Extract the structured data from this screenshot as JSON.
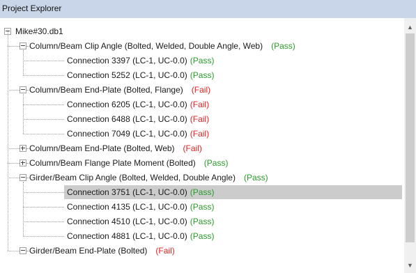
{
  "panel": {
    "title": "Project Explorer"
  },
  "tree": {
    "root": {
      "label": "Mike#30.db1"
    },
    "groups": [
      {
        "label": "Column/Beam Clip Angle (Bolted, Welded, Double Angle, Web)",
        "status": "(Pass)",
        "expanded": true,
        "connections": [
          {
            "label": "Connection 3397  (LC-1, UC-0.0)",
            "status": "(Pass)"
          },
          {
            "label": "Connection 5252  (LC-1, UC-0.0)",
            "status": "(Pass)"
          }
        ]
      },
      {
        "label": "Column/Beam End-Plate (Bolted, Flange)",
        "status": "(Fail)",
        "expanded": true,
        "connections": [
          {
            "label": "Connection 6205  (LC-1, UC-0.0)",
            "status": "(Fail)"
          },
          {
            "label": "Connection 6488  (LC-1, UC-0.0)",
            "status": "(Fail)"
          },
          {
            "label": "Connection 7049  (LC-1, UC-0.0)",
            "status": "(Fail)"
          }
        ]
      },
      {
        "label": "Column/Beam End-Plate (Bolted, Web)",
        "status": "(Fail)",
        "expanded": false,
        "connections": []
      },
      {
        "label": "Column/Beam Flange Plate Moment (Bolted)",
        "status": "(Pass)",
        "expanded": false,
        "connections": []
      },
      {
        "label": "Girder/Beam Clip Angle (Bolted, Welded, Double Angle)",
        "status": "(Pass)",
        "expanded": true,
        "connections": [
          {
            "label": "Connection 3751  (LC-1, UC-0.0)",
            "status": "(Pass)",
            "selected": true
          },
          {
            "label": "Connection 4135  (LC-1, UC-0.0)",
            "status": "(Pass)"
          },
          {
            "label": "Connection 4510  (LC-1, UC-0.0)",
            "status": "(Pass)"
          },
          {
            "label": "Connection 4881  (LC-1, UC-0.0)",
            "status": "(Pass)"
          }
        ]
      },
      {
        "label": "Girder/Beam End-Plate (Bolted)",
        "status": "(Fail)",
        "expanded": true,
        "connections": []
      }
    ]
  },
  "colors": {
    "pass": "#2a9a2a",
    "fail": "#e02020",
    "header": "#c9d5e8",
    "selected": "#cccccc"
  }
}
